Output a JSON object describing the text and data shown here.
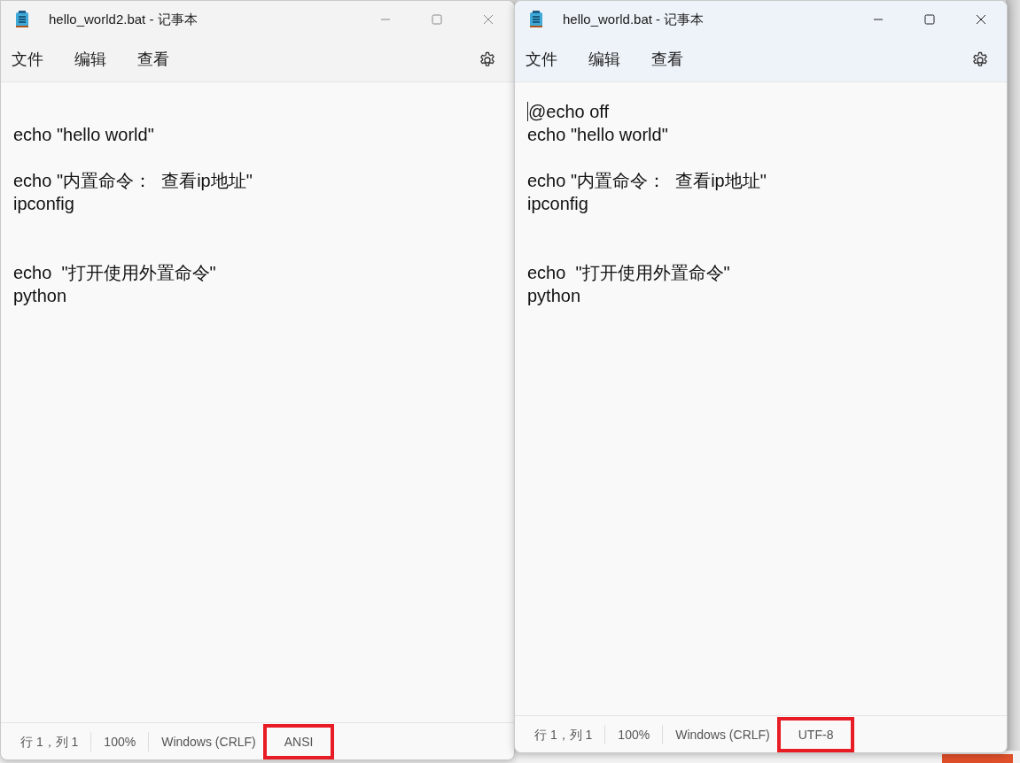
{
  "windows": [
    {
      "title": "hello_world2.bat - 记事本",
      "focused": false,
      "menu": [
        "文件",
        "编辑",
        "查看"
      ],
      "lines": [
        {
          "kind": "blank"
        },
        {
          "kind": "text",
          "text": "echo \"hello world\""
        },
        {
          "kind": "blank"
        },
        {
          "kind": "text",
          "text": "echo \"内置命令：  查看ip地址\""
        },
        {
          "kind": "text",
          "text": "ipconfig"
        },
        {
          "kind": "blank"
        },
        {
          "kind": "blank"
        },
        {
          "kind": "text",
          "text": "echo  \"打开使用外置命令\""
        },
        {
          "kind": "text",
          "text": "python"
        }
      ],
      "caret": false,
      "status_bar": [
        {
          "text": "行 1，列 1",
          "highlighted": false
        },
        {
          "text": "100%",
          "highlighted": false
        },
        {
          "text": "Windows (CRLF)",
          "highlighted": false
        },
        {
          "text": "ANSI",
          "highlighted": true
        }
      ]
    },
    {
      "title": "hello_world.bat - 记事本",
      "focused": true,
      "menu": [
        "文件",
        "编辑",
        "查看"
      ],
      "lines": [
        {
          "kind": "text",
          "text": "@echo off"
        },
        {
          "kind": "text",
          "text": "echo \"hello world\""
        },
        {
          "kind": "blank"
        },
        {
          "kind": "text",
          "text": "echo \"内置命令：  查看ip地址\""
        },
        {
          "kind": "text",
          "text": "ipconfig"
        },
        {
          "kind": "blank"
        },
        {
          "kind": "blank"
        },
        {
          "kind": "text",
          "text": "echo  \"打开使用外置命令\""
        },
        {
          "kind": "text",
          "text": "python"
        }
      ],
      "caret": true,
      "status_bar": [
        {
          "text": "行 1，列 1",
          "highlighted": false
        },
        {
          "text": "100%",
          "highlighted": false
        },
        {
          "text": "Windows (CRLF)",
          "highlighted": false
        },
        {
          "text": "UTF-8",
          "highlighted": true
        }
      ]
    }
  ]
}
